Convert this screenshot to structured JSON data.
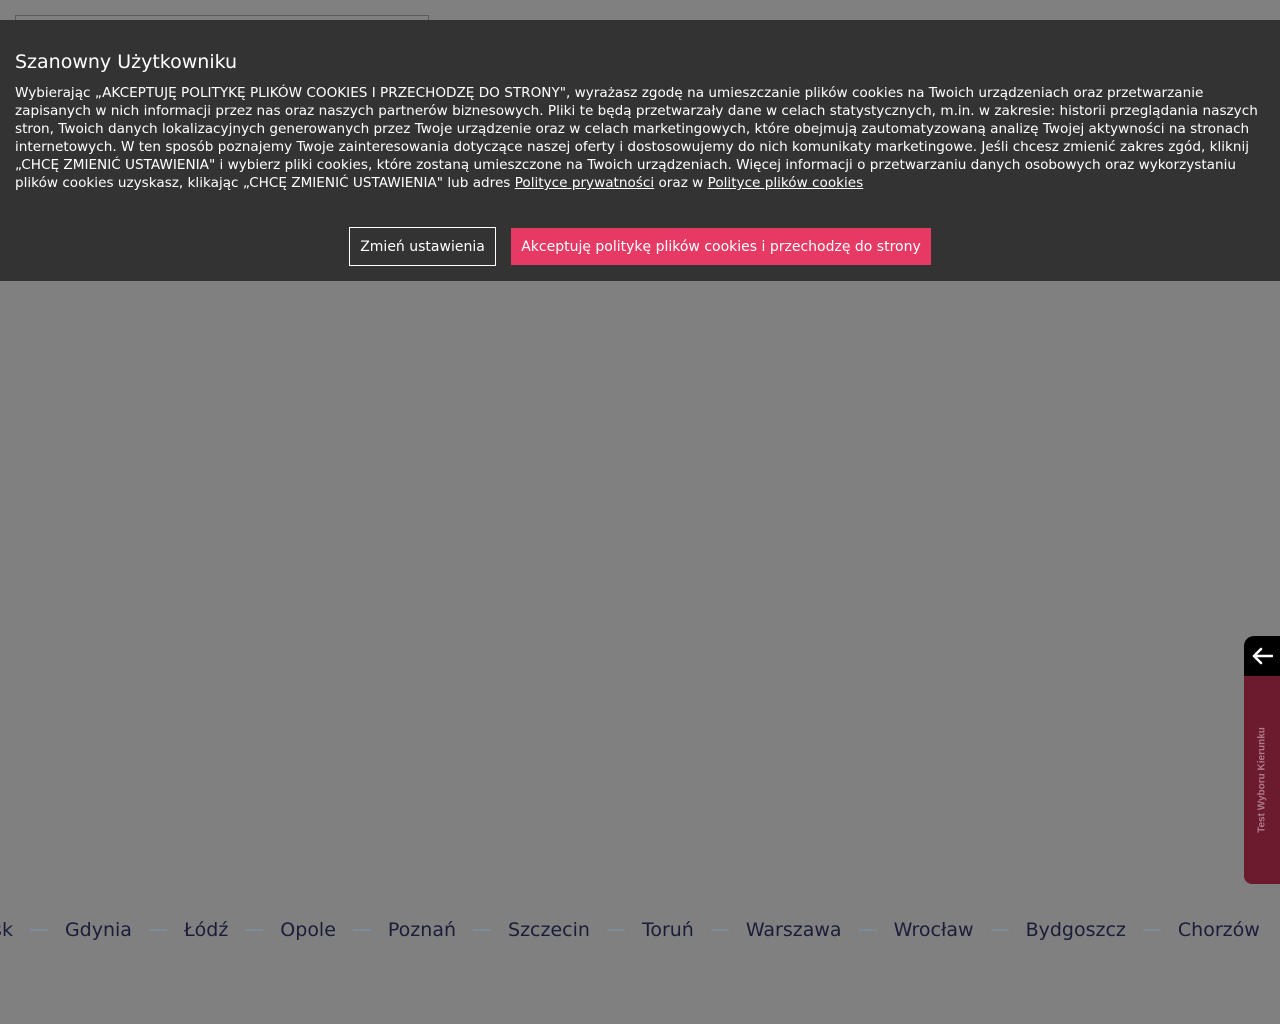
{
  "cookie_banner": {
    "title": "Szanowny Użytkowniku",
    "text_1": "Wybierając „AKCEPTUJĘ POLITYKĘ PLIKÓW COOKIES I PRZECHODZĘ DO STRONY\", wyrażasz zgodę na umieszczanie plików cookies na Twoich urządzeniach oraz przetwarzanie zapisanych w nich informacji przez nas oraz naszych partnerów biznesowych. Pliki te będą przetwarzały dane w celach statystycznych, m.in. w zakresie: historii przeglądania naszych stron, Twoich danych lokalizacyjnych generowanych przez Twoje urządzenie oraz w celach marketingowych, które obejmują zautomatyzowaną analizę Twojej aktywności na stronach internetowych. W ten sposób poznajemy Twoje zainteresowania dotyczące naszej oferty i dostosowujemy do nich komunikaty marketingowe. Jeśli chcesz zmienić zakres zgód, kliknij „CHCĘ ZMIENIĆ USTAWIENIA\" i wybierz pliki cookies, które zostaną umieszczone na Twoich urządzeniach. Więcej informacji o przetwarzaniu danych osobowych oraz wykorzystaniu plików cookies uzyskasz, klikając „CHCĘ ZMIENIĆ USTAWIENIA\" lub adres ",
    "privacy_link": "Polityce prywatności",
    "text_2": " oraz w ",
    "cookies_link": "Polityce plików cookies",
    "settings_button": "Zmień ustawienia",
    "accept_button": "Akceptuję politykę plików cookies i przechodzę do strony"
  },
  "side_widget": {
    "label": "Test Wyboru Kierunku",
    "arrow_icon": "arrow-left-icon"
  },
  "cities": [
    "ńsk",
    "Gdynia",
    "Łódź",
    "Opole",
    "Poznań",
    "Szczecin",
    "Toruń",
    "Warszawa",
    "Wrocław",
    "Bydgoszcz",
    "Chorzów"
  ],
  "colors": {
    "overlay": "#808080",
    "banner": "#333333",
    "accent": "#e63a64",
    "side_tab": "#6b1b2d",
    "city_text": "#1a1d38"
  }
}
